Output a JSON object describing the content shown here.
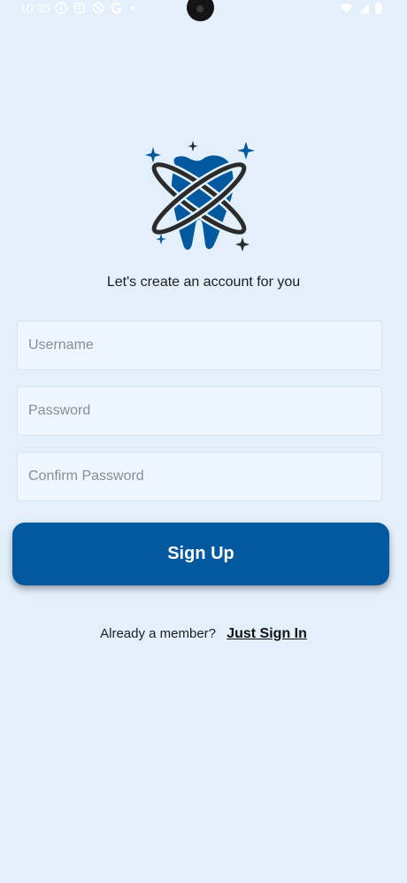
{
  "status_bar": {
    "time": "10:35"
  },
  "header": {
    "subtitle": "Let's create an account for you"
  },
  "form": {
    "username_placeholder": "Username",
    "password_placeholder": "Password",
    "confirm_password_placeholder": "Confirm Password",
    "signup_label": "Sign Up"
  },
  "footer": {
    "prompt": "Already a member?",
    "signin_link": "Just Sign In"
  },
  "colors": {
    "background": "#e3f0fc",
    "primary": "#02599f",
    "field_bg": "#eef6ff"
  }
}
